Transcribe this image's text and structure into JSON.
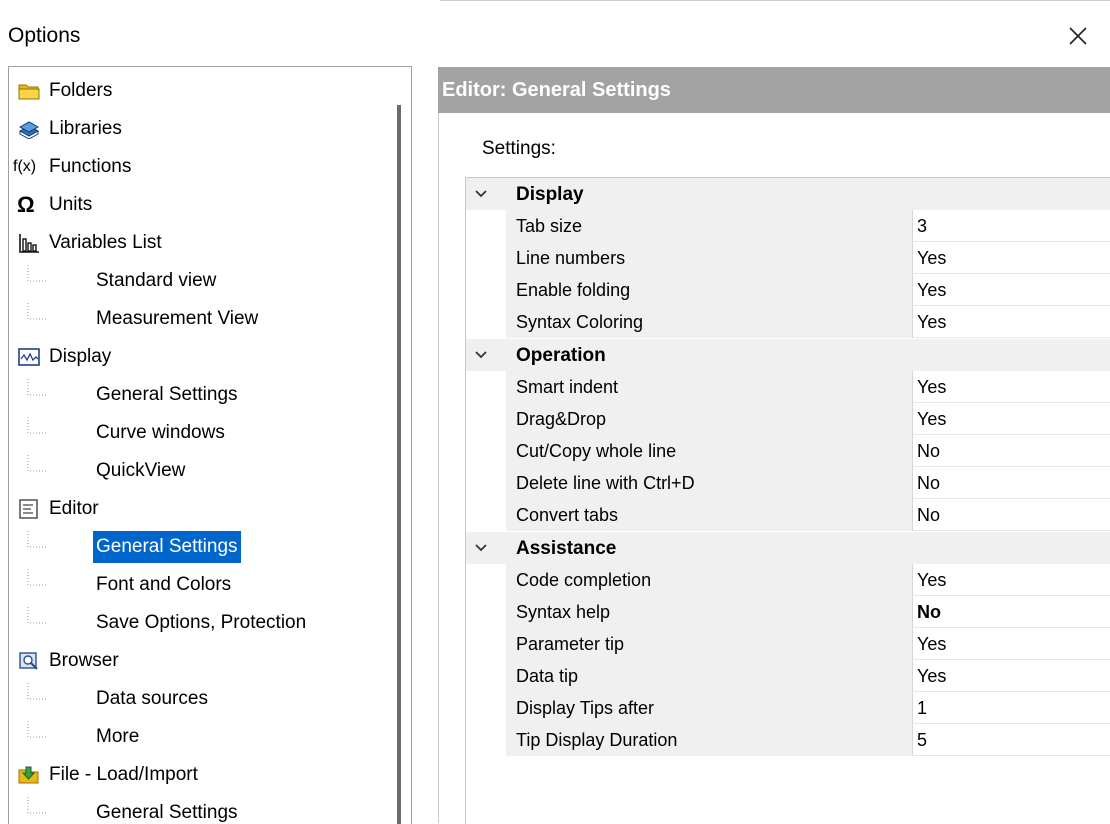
{
  "window": {
    "title": "Options"
  },
  "tree": {
    "items": [
      {
        "label": "Folders",
        "icon": "folder-icon",
        "level": 0
      },
      {
        "label": "Libraries",
        "icon": "books-icon",
        "level": 0
      },
      {
        "label": "Functions",
        "icon": "function-icon",
        "level": 0
      },
      {
        "label": "Units",
        "icon": "omega-icon",
        "level": 0
      },
      {
        "label": "Variables List",
        "icon": "chart-bars-icon",
        "level": 0
      },
      {
        "label": "Standard view",
        "level": 1
      },
      {
        "label": "Measurement View",
        "level": 1
      },
      {
        "label": "Display",
        "icon": "waveform-icon",
        "level": 0
      },
      {
        "label": "General Settings",
        "level": 1
      },
      {
        "label": "Curve windows",
        "level": 1
      },
      {
        "label": "QuickView",
        "level": 1
      },
      {
        "label": "Editor",
        "icon": "document-icon",
        "level": 0
      },
      {
        "label": "General Settings",
        "level": 1,
        "selected": true
      },
      {
        "label": "Font and Colors",
        "level": 1
      },
      {
        "label": "Save Options, Protection",
        "level": 1
      },
      {
        "label": "Browser",
        "icon": "browser-icon",
        "level": 0
      },
      {
        "label": "Data sources",
        "level": 1
      },
      {
        "label": "More",
        "level": 1
      },
      {
        "label": "File - Load/Import",
        "icon": "file-load-icon",
        "level": 0
      },
      {
        "label": "General Settings",
        "level": 1
      }
    ],
    "function_icon_text": "f(x)",
    "omega_icon_text": "Ω"
  },
  "panel": {
    "header": "Editor: General Settings",
    "settings_label": "Settings:"
  },
  "grid": {
    "categories": [
      {
        "label": "Display",
        "rows": [
          {
            "name": "Tab size",
            "value": "3"
          },
          {
            "name": "Line numbers",
            "value": "Yes"
          },
          {
            "name": "Enable folding",
            "value": "Yes"
          },
          {
            "name": "Syntax Coloring",
            "value": "Yes"
          }
        ]
      },
      {
        "label": "Operation",
        "rows": [
          {
            "name": "Smart indent",
            "value": "Yes"
          },
          {
            "name": "Drag&Drop",
            "value": "Yes"
          },
          {
            "name": "Cut/Copy whole line",
            "value": "No"
          },
          {
            "name": "Delete line with Ctrl+D",
            "value": "No"
          },
          {
            "name": "Convert tabs",
            "value": "No"
          }
        ]
      },
      {
        "label": "Assistance",
        "rows": [
          {
            "name": "Code completion",
            "value": "Yes"
          },
          {
            "name": "Syntax help",
            "value": "No",
            "bold": true
          },
          {
            "name": "Parameter tip",
            "value": "Yes"
          },
          {
            "name": "Data tip",
            "value": "Yes"
          },
          {
            "name": "Display Tips after",
            "value": "1"
          },
          {
            "name": "Tip Display Duration",
            "value": "5"
          }
        ]
      }
    ]
  },
  "colors": {
    "selection": "#0066cc",
    "header_bg": "#a3a3a3",
    "category_bg": "#f0f0f0"
  }
}
